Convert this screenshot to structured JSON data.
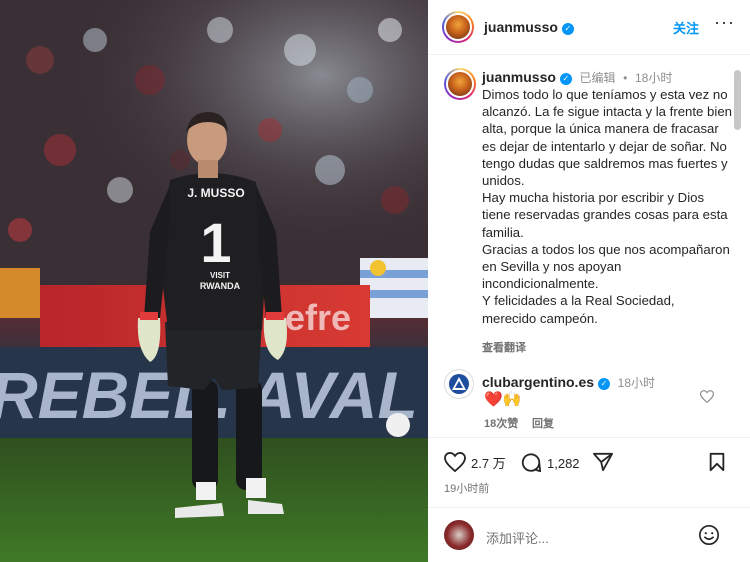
{
  "post": {
    "author": "juanmusso",
    "follow_label": "关注",
    "more_label": "···",
    "jersey_name": "J. MUSSO",
    "jersey_number": "1",
    "jersey_sponsor_line1": "VISIT",
    "jersey_sponsor_line2": "RWANDA",
    "banner_text": "REBEL. AVAL",
    "board_text": "efre"
  },
  "caption": {
    "author": "juanmusso",
    "edited_label": "已编辑",
    "separator": "•",
    "time": "18小时",
    "lines": [
      "Dimos todo lo que teníamos y esta vez no alcanzó. La fe sigue intacta y la frente bien alta, porque la única manera de fracasar es dejar de intentarlo y dejar de soñar. No tengo dudas que saldremos mas fuertes y unidos.",
      "Hay mucha historia por escribir y Dios tiene reservadas grandes cosas para esta familia.",
      "Gracias a todos los que nos acompañaron en Sevilla y nos apoyan incondicionalmente.",
      "Y felicidades a la Real Sociedad, merecido campeón."
    ],
    "translate_label": "查看翻译"
  },
  "comment": {
    "author": "clubargentino.es",
    "time": "18小时",
    "emoji": "❤️🙌",
    "likes": "18次赞",
    "reply_label": "回复"
  },
  "actions": {
    "like_count": "2.7 万",
    "comment_count": "1,282",
    "posted_time": "19小时前"
  },
  "composer": {
    "placeholder": "添加评论..."
  },
  "colors": {
    "accent": "#0095f6",
    "liked_red": "#ed4956",
    "jersey": "#1f1f22"
  }
}
